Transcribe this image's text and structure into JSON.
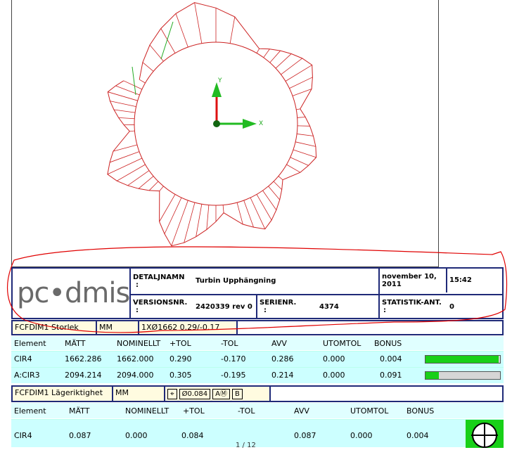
{
  "plot": {
    "axis_y": "Y",
    "axis_x": "X"
  },
  "header": {
    "logo_text": "pc•dmis",
    "detaljnamn_label": "DETALJNAMN",
    "detaljnamn_colon": ":",
    "detaljnamn_value": "Turbin Upphängning",
    "date": "november 10, 2011",
    "time": "15:42",
    "versionsnr_label": "VERSIONSNR.",
    "versionsnr_colon": ":",
    "versionsnr_value": "2420339 rev 0",
    "serienr_label": "SERIENR.",
    "serienr_colon": ":",
    "serienr_value": "4374",
    "statistik_label": "STATISTIK-ANT.",
    "statistik_colon": ":",
    "statistik_value": "0"
  },
  "fcf1": {
    "name": "FCFDIM1 Storlek",
    "units": "MM",
    "spec": "1XØ1662  0.29/-0.17"
  },
  "table1": {
    "headers": [
      "Element",
      "MÄTT",
      "NOMINELLT",
      "+TOL",
      "-TOL",
      "AVV",
      "UTOMTOL",
      "BONUS"
    ],
    "rows": [
      {
        "cells": [
          "CIR4",
          "1662.286",
          "1662.000",
          "0.290",
          "-0.170",
          "0.286",
          "0.000",
          "0.004"
        ],
        "bar_fraction": 0.98
      },
      {
        "cells": [
          "A:CIR3",
          "2094.214",
          "2094.000",
          "0.305",
          "-0.195",
          "0.214",
          "0.000",
          "0.091"
        ],
        "bar_fraction": 0.18
      }
    ]
  },
  "fcf2": {
    "name": "FCFDIM1 Lägeriktighet",
    "units": "MM",
    "sym_position": "⌖",
    "sym_tol": "Ø0.084",
    "sym_mod1": "Ⓜ",
    "sym_datum_a": "AⓂ",
    "sym_datum_b": "B"
  },
  "table2": {
    "headers": [
      "Element",
      "MÄTT",
      "NOMINELLT",
      "+TOL",
      "-TOL",
      "AVV",
      "UTOMTOL",
      "BONUS"
    ],
    "rows": [
      {
        "cells": [
          "CIR4",
          "0.087",
          "0.000",
          "0.084",
          "",
          "0.087",
          "0.000",
          "0.004"
        ]
      }
    ]
  },
  "page_indicator": "1 / 12",
  "colors": {
    "border_blue": "#1f2a78",
    "annotation_red": "#e00000",
    "plot_red": "#cc2222",
    "bar_green": "#18d018",
    "row_cyan": "#ccffff",
    "cell_yellow": "#fffbe0"
  }
}
